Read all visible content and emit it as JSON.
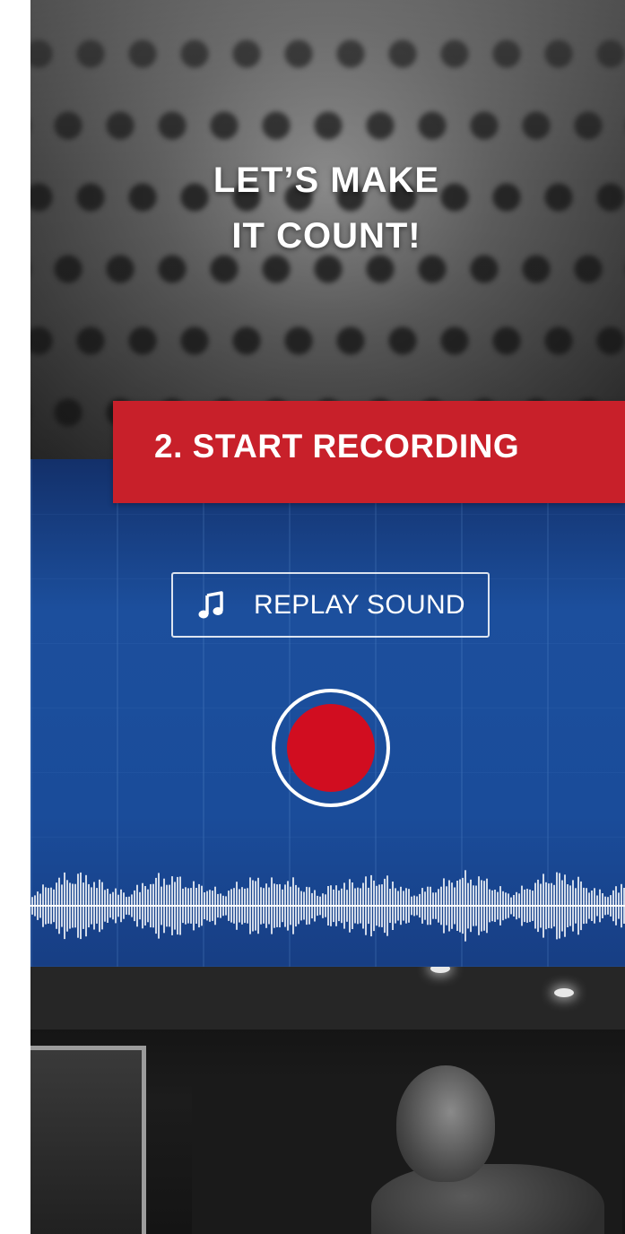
{
  "hero": {
    "title_line1": "LET’S MAKE",
    "title_line2": "IT COUNT!"
  },
  "step": {
    "label": "2. START RECORDING",
    "banner_color": "#c8202a"
  },
  "replay": {
    "icon": "music-note-icon",
    "label": "REPLAY SOUND"
  },
  "record": {
    "icon": "record-icon",
    "color": "#d10d20"
  },
  "colors": {
    "panel_blue": "#1c4f9d",
    "accent_red": "#c8202a"
  }
}
